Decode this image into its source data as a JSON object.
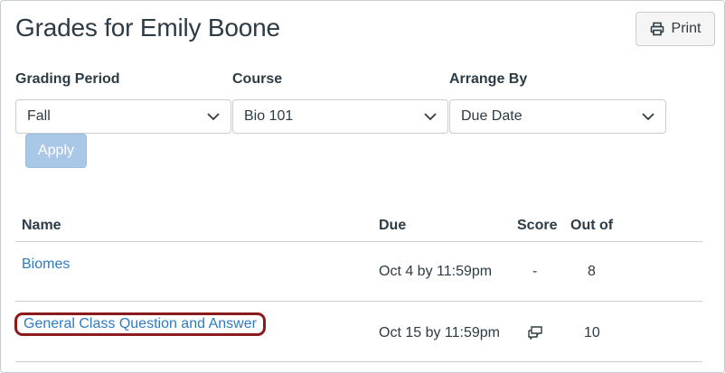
{
  "page": {
    "title": "Grades for Emily Boone",
    "print_label": "Print"
  },
  "filters": {
    "grading_period": {
      "label": "Grading Period",
      "value": "Fall"
    },
    "course": {
      "label": "Course",
      "value": "Bio 101"
    },
    "arrange_by": {
      "label": "Arrange By",
      "value": "Due Date"
    },
    "apply_label": "Apply"
  },
  "table": {
    "headers": {
      "name": "Name",
      "due": "Due",
      "score": "Score",
      "out_of": "Out of"
    },
    "rows": [
      {
        "name": "Biomes",
        "due": "Oct 4 by 11:59pm",
        "score": "-",
        "out_of": "8"
      },
      {
        "name": "General Class Question and Answer",
        "due": "Oct 15 by 11:59pm",
        "score_icon": "comment-icon",
        "out_of": "10"
      }
    ]
  },
  "colors": {
    "link": "#2d7bc3",
    "text": "#2d3b45",
    "apply_disabled": "#a9c7e6",
    "highlight_outline": "#8b1a1a",
    "border": "#c7cdd1"
  }
}
